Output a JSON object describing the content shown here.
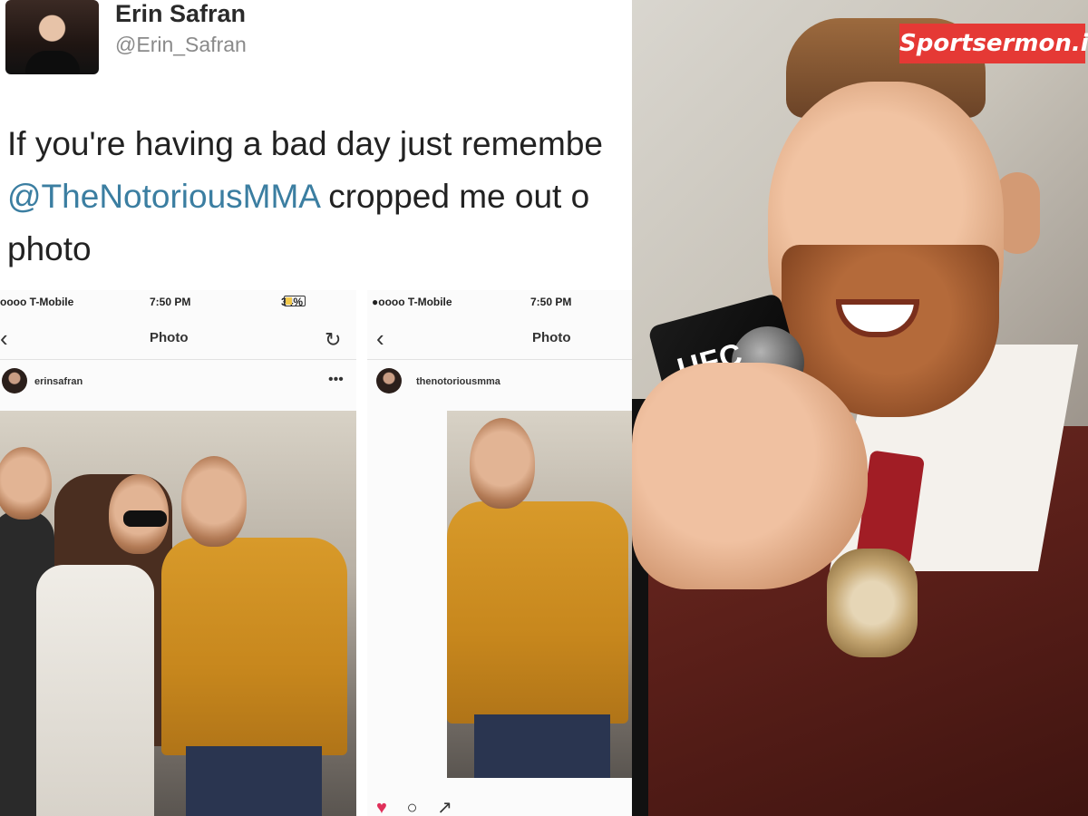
{
  "tweet": {
    "author_name": "Erin Safran",
    "author_handle": "@Erin_Safran",
    "text_line1": "If you're having a bad day just remembe",
    "mention": "@TheNotoriousMMA",
    "text_line2_rest": " cropped me out o",
    "text_line3": "photo"
  },
  "phone_left": {
    "carrier": "oooo T-Mobile",
    "time": "7:50 PM",
    "battery": "34%",
    "title": "Photo",
    "username": "erinsafran",
    "more_icon": "more-icon",
    "refresh_icon": "refresh-icon"
  },
  "phone_right": {
    "carrier": "●oooo T-Mobile",
    "time": "7:50 PM",
    "title": "Photo",
    "username": "thenotoriousmma",
    "actions": [
      "heart-icon",
      "comment-icon",
      "share-icon"
    ]
  },
  "right_photo": {
    "mic_label": "UFC",
    "watermark": "Sportsermon.in"
  },
  "colors": {
    "mention": "#3b7ea1",
    "watermark_bg": "#e53935",
    "heart": "#e0305a"
  }
}
